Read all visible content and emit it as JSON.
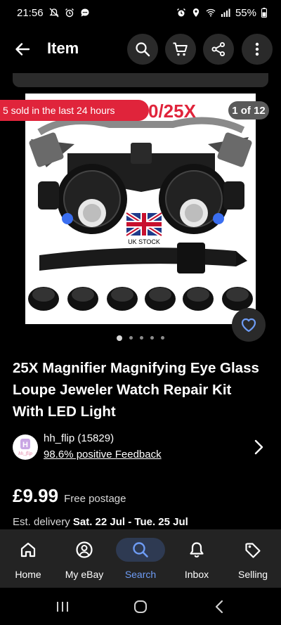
{
  "status_bar": {
    "time": "21:56",
    "battery": "55%"
  },
  "header": {
    "title": "Item"
  },
  "listing": {
    "sold_banner": "5 sold in the last 24 hours",
    "image_counter": "1 of 12",
    "image_overlay_text": "0/25X",
    "flag_caption": "UK STOCK",
    "title": "25X Magnifier Magnifying Eye Glass Loupe Jeweler Watch Repair Kit With LED Light",
    "seller": {
      "name": "hh_flip (15829)",
      "feedback": "98.6% positive Feedback",
      "avatar_letter": "H",
      "avatar_text": "hh_flip"
    },
    "price": "£9.99",
    "postage": "Free postage",
    "delivery_prefix": "Est. delivery",
    "delivery_dates": "Sat. 22 Jul - Tue. 25 Jul",
    "carousel": {
      "count": 5,
      "active": 0
    }
  },
  "nav": {
    "items": [
      {
        "label": "Home",
        "icon": "home-icon"
      },
      {
        "label": "My eBay",
        "icon": "person-icon"
      },
      {
        "label": "Search",
        "icon": "search-icon",
        "active": true
      },
      {
        "label": "Inbox",
        "icon": "bell-icon"
      },
      {
        "label": "Selling",
        "icon": "tag-icon"
      }
    ]
  },
  "colors": {
    "sold_banner": "#e0243b",
    "active_nav": "#6e9cf5",
    "background": "#000000"
  }
}
